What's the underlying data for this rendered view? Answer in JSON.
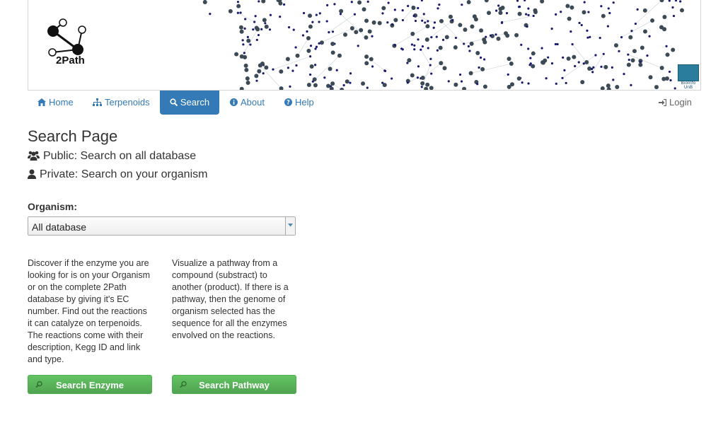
{
  "banner": {
    "logo_text": "2Path",
    "partner_line1": "BioInfo",
    "partner_line2": "UnB"
  },
  "nav": {
    "home": "Home",
    "terpenoids": "Terpenoids",
    "search": "Search",
    "about": "About",
    "help": "Help",
    "login": "Login"
  },
  "page": {
    "title": "Search Page",
    "public_line": "Public: Search on all database",
    "private_line": "Private: Search on your organism"
  },
  "organism": {
    "label": "Organism:",
    "selected": "All database"
  },
  "enzyme": {
    "description": "Discover if the enzyme you are looking for is on your Organism or on the complete 2Path database by giving it's EC number. Find out the reactions it can catalyze on terpenoids. The reactions come with their description, Kegg ID and link and type.",
    "button": "Search Enzyme"
  },
  "pathway": {
    "description": "Visualize a pathway from a compound (substract) to another (product). If there is a pathway, then the genome of organism selected has the sequence for all the enzymes envolved on the reactions.",
    "button": "Search Pathway"
  },
  "colors": {
    "accent": "#337ab7",
    "button_green": "#5cb85c"
  }
}
